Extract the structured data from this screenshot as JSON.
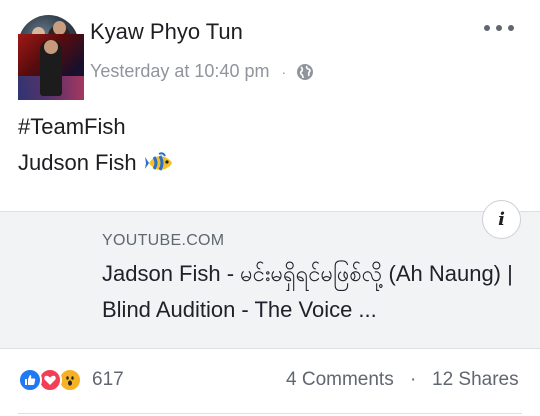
{
  "post": {
    "author": "Kyaw Phyo Tun",
    "timestamp": "Yesterday at 10:40 pm",
    "separator": "·",
    "privacy_icon": "globe-icon",
    "more_icon": "more-horizontal-icon",
    "text_line1": "#TeamFish",
    "text_line2": "Judson Fish",
    "emoji_icon": "tropical-fish-icon"
  },
  "link_preview": {
    "domain": "YOUTUBE.COM",
    "title": "Jadson Fish - မင်းမရှိရင်မဖြစ်လို့ (Ah Naung) | Blind Audition - The Voice ...",
    "info_label": "i"
  },
  "footer": {
    "reaction_icons": [
      "like-icon",
      "love-icon",
      "wow-icon"
    ],
    "reaction_count": "617",
    "comments": "4 Comments",
    "separator": "·",
    "shares": "12 Shares"
  },
  "colors": {
    "like": "#2078f4",
    "love": "#f33e58",
    "wow": "#f7b125",
    "meta_text": "#90949c",
    "card_bg": "#f2f3f5"
  }
}
